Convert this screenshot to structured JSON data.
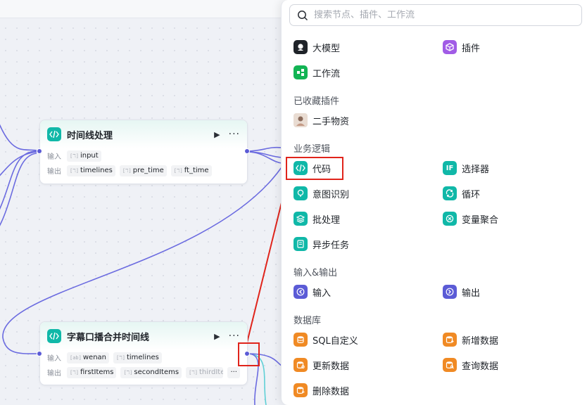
{
  "canvas": {
    "nodes": [
      {
        "title": "时间线处理",
        "run_icon": "▶",
        "more_icon": "···",
        "inputs_label": "输入",
        "outputs_label": "输出",
        "inputs": [
          {
            "type": "[ℸ]",
            "name": "input"
          }
        ],
        "outputs": [
          {
            "type": "[ℸ]",
            "name": "timelines"
          },
          {
            "type": "[ℸ]",
            "name": "pre_time"
          },
          {
            "type": "[ℸ]",
            "name": "ft_time"
          }
        ]
      },
      {
        "title": "字幕口播合并时间线",
        "run_icon": "▶",
        "more_icon": "···",
        "inputs_label": "输入",
        "outputs_label": "输出",
        "inputs": [
          {
            "type": "[ab]",
            "name": "wenan"
          },
          {
            "type": "[ℸ]",
            "name": "timelines"
          }
        ],
        "outputs": [
          {
            "type": "[ℸ]",
            "name": "firstItems"
          },
          {
            "type": "[ℸ]",
            "name": "secondItems"
          },
          {
            "type": "[ℸ]",
            "name": "thirdIte"
          }
        ],
        "outputs_more": "···"
      }
    ]
  },
  "panel": {
    "search_placeholder": "搜索节点、插件、工作流",
    "top_items": [
      {
        "label": "大模型",
        "icon": "llm-icon",
        "color": "#1f2329"
      },
      {
        "label": "插件",
        "icon": "plugin-icon",
        "color": "#a15ce6"
      },
      {
        "label": "工作流",
        "icon": "workflow-icon",
        "color": "#12b454"
      }
    ],
    "sections": [
      {
        "title": "已收藏插件",
        "items": [
          {
            "label": "二手物资",
            "icon": "avatar-icon"
          }
        ]
      },
      {
        "title": "业务逻辑",
        "items": [
          {
            "label": "代码",
            "icon": "code-icon",
            "color": "#10b8a8"
          },
          {
            "label": "选择器",
            "icon": "selector-icon",
            "color": "#10b8a8"
          },
          {
            "label": "意图识别",
            "icon": "intent-icon",
            "color": "#10b8a8"
          },
          {
            "label": "循环",
            "icon": "loop-icon",
            "color": "#10b8a8"
          },
          {
            "label": "批处理",
            "icon": "batch-icon",
            "color": "#10b8a8"
          },
          {
            "label": "变量聚合",
            "icon": "aggregate-icon",
            "color": "#10b8a8"
          },
          {
            "label": "异步任务",
            "icon": "async-task-icon",
            "color": "#10b8a8"
          }
        ]
      },
      {
        "title": "输入&输出",
        "items": [
          {
            "label": "输入",
            "icon": "input-icon",
            "color": "#5b5bd6"
          },
          {
            "label": "输出",
            "icon": "output-icon",
            "color": "#5b5bd6"
          }
        ]
      },
      {
        "title": "数据库",
        "items": [
          {
            "label": "SQL自定义",
            "icon": "sql-icon",
            "color": "#f08a24"
          },
          {
            "label": "新增数据",
            "icon": "db-add-icon",
            "color": "#f08a24"
          },
          {
            "label": "更新数据",
            "icon": "db-update-icon",
            "color": "#f08a24"
          },
          {
            "label": "查询数据",
            "icon": "db-query-icon",
            "color": "#f08a24"
          },
          {
            "label": "删除数据",
            "icon": "db-delete-icon",
            "color": "#f08a24"
          }
        ]
      }
    ]
  },
  "colors": {
    "accent_teal": "#10b8a8",
    "port_purple": "#5b5bd6",
    "annotation_red": "#e0241b"
  }
}
